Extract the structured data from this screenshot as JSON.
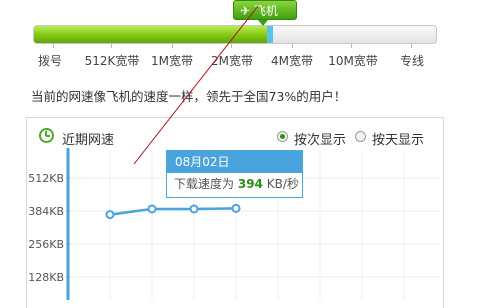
{
  "speed_badge": {
    "label": "飞机",
    "icon": "airplane-icon",
    "color": "#3f9f0f"
  },
  "speed_level_fraction": 0.58,
  "speed_scale": [
    "拨号",
    "512K宽带",
    "1M宽带",
    "2M宽带",
    "4M宽带",
    "10M宽带",
    "专线"
  ],
  "status_message": "当前的网速像飞机的速度一样，领先于全国73%的用户！",
  "panel": {
    "title": "近期网速",
    "icon": "clock-icon",
    "view_options": [
      {
        "label": "按次显示",
        "selected": true
      },
      {
        "label": "按天显示",
        "selected": false
      }
    ]
  },
  "tooltip": {
    "date": "08月02日",
    "label": "下载速度为",
    "value": "394",
    "unit": "KB/秒",
    "header_color": "#49a3dc"
  },
  "chart_data": {
    "type": "line",
    "title": "近期网速",
    "y_ticks": [
      "512KB",
      "384KB",
      "256KB",
      "128KB"
    ],
    "ylim": [
      0,
      600
    ],
    "series": [
      {
        "values": [
          370,
          392,
          392,
          394
        ]
      }
    ],
    "line_color": "#49a3dc",
    "grid": true
  }
}
